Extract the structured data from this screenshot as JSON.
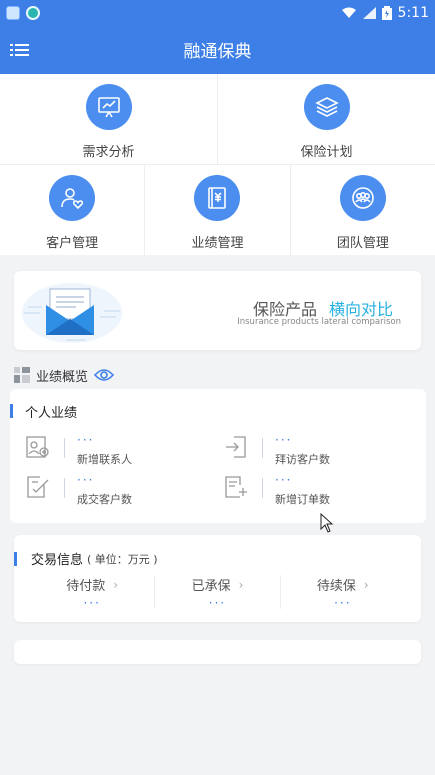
{
  "status_bar": {
    "time": "5:11"
  },
  "app": {
    "title": "融通保典"
  },
  "grid": {
    "top": [
      {
        "label": "需求分析",
        "icon": "analysis-chart-icon"
      },
      {
        "label": "保险计划",
        "icon": "layers-icon"
      }
    ],
    "bottom": [
      {
        "label": "客户管理",
        "icon": "customer-heart-icon"
      },
      {
        "label": "业绩管理",
        "icon": "yuan-book-icon"
      },
      {
        "label": "团队管理",
        "icon": "team-icon"
      }
    ]
  },
  "banner": {
    "title_plain": "保险产品",
    "title_accent": "横向对比",
    "subtitle": "Insurance products lateral comparison"
  },
  "overview": {
    "label": "业绩概览"
  },
  "personal": {
    "title": "个人业绩",
    "metrics": [
      {
        "value": "···",
        "label": "新增联系人"
      },
      {
        "value": "···",
        "label": "拜访客户数"
      },
      {
        "value": "···",
        "label": "成交客户数"
      },
      {
        "value": "···",
        "label": "新增订单数"
      }
    ]
  },
  "trade": {
    "title": "交易信息",
    "unit": "( 单位：万元 )",
    "cols": [
      {
        "label": "待付款",
        "value": "···"
      },
      {
        "label": "已承保",
        "value": "···"
      },
      {
        "label": "待续保",
        "value": "···"
      }
    ]
  },
  "colors": {
    "primary": "#3d7fe6",
    "accent": "#27b0e0",
    "background": "#f2f3f5"
  }
}
